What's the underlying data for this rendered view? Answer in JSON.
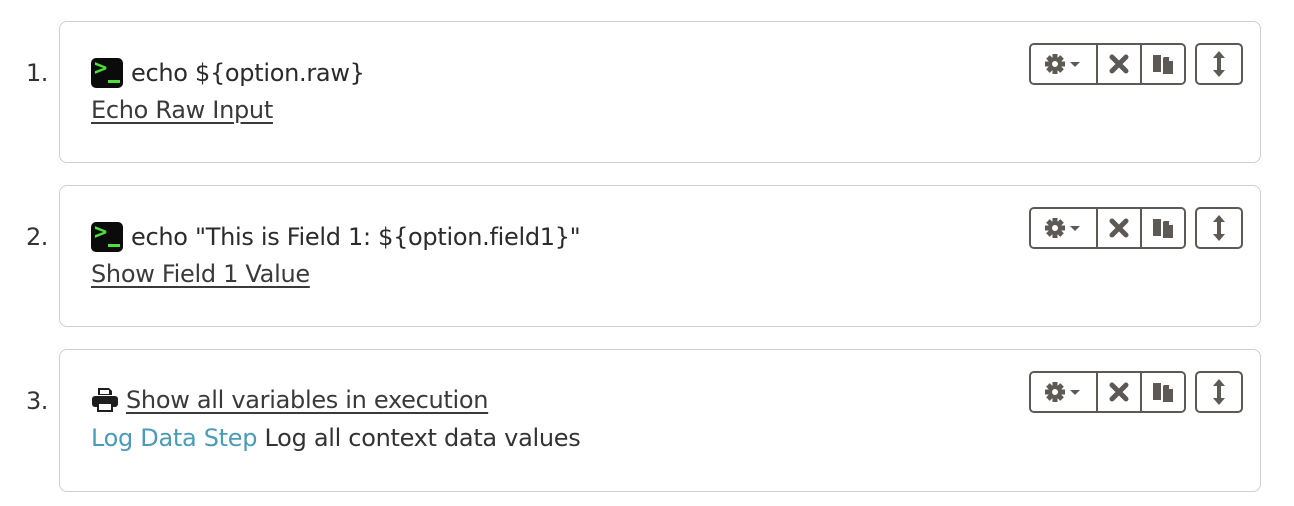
{
  "steps": [
    {
      "number": "1.",
      "type": "command",
      "icon": "terminal-icon",
      "command": "echo ${option.raw}",
      "description": "Echo Raw Input"
    },
    {
      "number": "2.",
      "type": "command",
      "icon": "terminal-icon",
      "command": "echo \"This is Field 1: ${option.field1}\"",
      "description": "Show Field 1 Value"
    },
    {
      "number": "3.",
      "type": "plugin",
      "icon": "print-icon",
      "description": "Show all variables in execution",
      "plugin_name": "Log Data Step",
      "plugin_description": "Log all context data values"
    }
  ],
  "toolbar": {
    "buttons": [
      "gear-dropdown",
      "delete",
      "duplicate",
      "move"
    ]
  },
  "colors": {
    "plugin_name": "#4a9bb7",
    "terminal_green": "#4ee03c",
    "button_border": "#5d5955",
    "card_border": "#cfcfcb"
  }
}
